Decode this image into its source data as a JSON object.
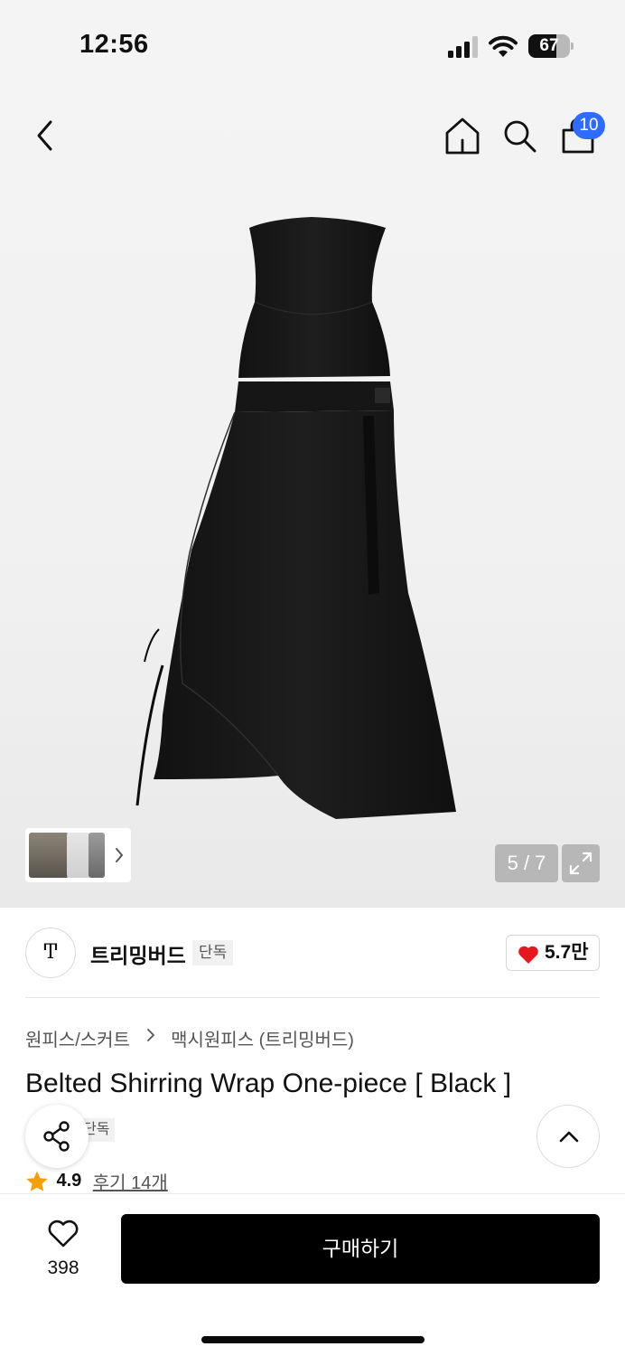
{
  "status_bar": {
    "time": "12:56",
    "battery": "67",
    "battery_level": 0.67
  },
  "nav": {
    "cart_count": "10"
  },
  "gallery": {
    "counter": "5 / 7"
  },
  "brand": {
    "logo": "Ͳ",
    "name": "트리밍버드",
    "tag": "단독",
    "likes": "5.7만"
  },
  "breadcrumb": {
    "category": "원피스/스커트",
    "subcategory": "맥시원피스 (트리밍버드)"
  },
  "product": {
    "title": "Belted Shirring Wrap One-piece [ Black ]",
    "tag": "단독",
    "rating": "4.9",
    "reviews": "후기 14개"
  },
  "bottom_bar": {
    "wish_count": "398",
    "buy_label": "구매하기"
  },
  "colors": {
    "accent": "#2f6bff",
    "heart": "#e8161f",
    "star": "#f5a000",
    "button": "#000000"
  }
}
